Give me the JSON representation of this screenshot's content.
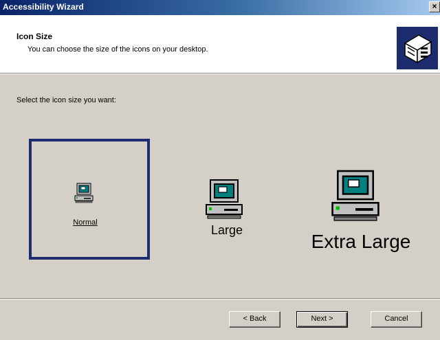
{
  "window": {
    "title": "Accessibility Wizard",
    "close_label": "×"
  },
  "header": {
    "title": "Icon Size",
    "subtitle": "You can choose the size of the icons on your desktop.",
    "icon": "wizard-icon"
  },
  "main": {
    "prompt": "Select the icon size you want:",
    "options": [
      {
        "label": "Normal",
        "icon": "computer-icon",
        "selected": true
      },
      {
        "label": "Large",
        "icon": "computer-icon",
        "selected": false
      },
      {
        "label": "Extra Large",
        "icon": "computer-icon",
        "selected": false
      }
    ]
  },
  "buttons": {
    "back": "< Back",
    "next": "Next >",
    "cancel": "Cancel"
  },
  "colors": {
    "title_bar": "#0a246a",
    "selection_border": "#1c2c6e",
    "dialog_bg": "#d4d0c8"
  }
}
